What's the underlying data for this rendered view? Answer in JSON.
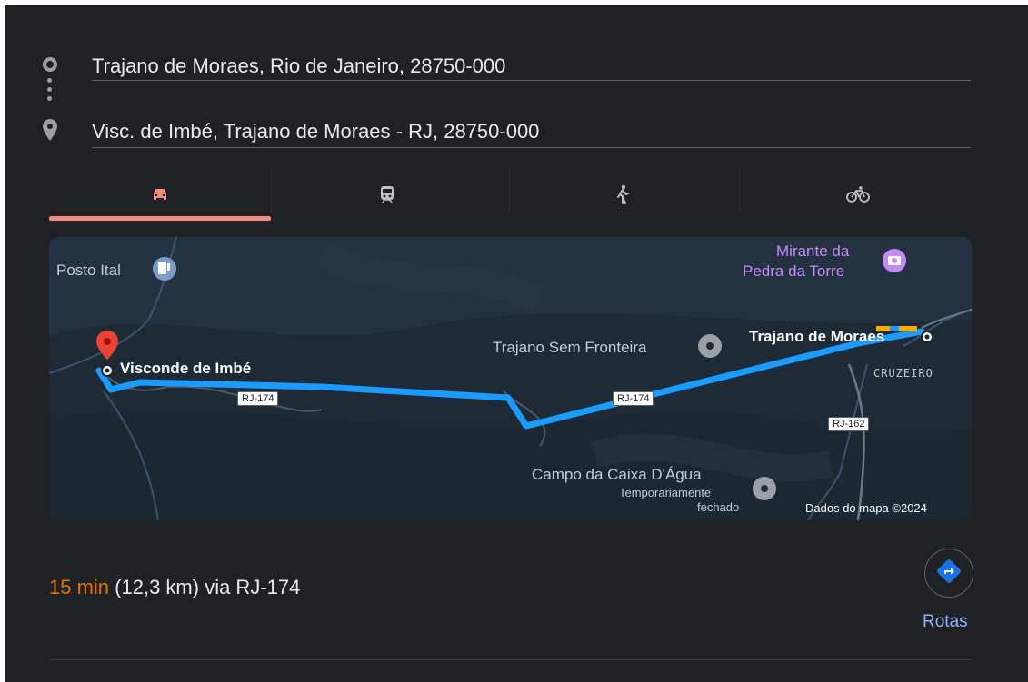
{
  "route": {
    "origin": "Trajano de Moraes, Rio de Janeiro, 28750-000",
    "destination": "Visc. de Imbé, Trajano de Moraes - RJ, 28750-000"
  },
  "tabs": [
    {
      "name": "car",
      "icon": "car-icon",
      "active": true
    },
    {
      "name": "transit",
      "icon": "train-icon",
      "active": false
    },
    {
      "name": "walk",
      "icon": "walk-icon",
      "active": false
    },
    {
      "name": "bike",
      "icon": "bike-icon",
      "active": false
    }
  ],
  "map": {
    "labels": {
      "posto": "Posto Ital",
      "mirante_1": "Mirante da",
      "mirante_2": "Pedra da Torre",
      "trajano_sem_fronteira": "Trajano Sem Fronteira",
      "trajano_de_moraes": "Trajano de Moraes",
      "visconde": "Visconde de Imbé",
      "cruzeiro": "CRUZEIRO",
      "campo": "Campo da Caixa D'Água",
      "temporariamente": "Temporariamente",
      "fechado": "fechado",
      "rj174_a": "RJ-174",
      "rj174_b": "RJ-174",
      "rj162": "RJ-162",
      "attribution": "Dados do mapa ©2024"
    }
  },
  "summary": {
    "duration": "15 min",
    "details": "(12,3 km) via RJ-174"
  },
  "actions": {
    "rotas_label": "Rotas"
  },
  "colors": {
    "background": "#202124",
    "route": "#1a9cff",
    "active_tab": "#f28b82",
    "duration": "#e37400",
    "link": "#8ab4f8"
  }
}
